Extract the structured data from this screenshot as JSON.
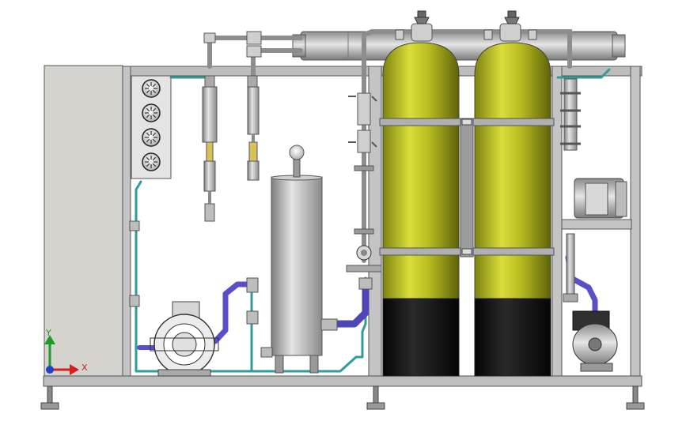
{
  "view": {
    "background": "#ffffff",
    "triad": {
      "x_label": "X",
      "y_label": "Y",
      "x_color": "#d42020",
      "y_color": "#1f9a2a",
      "z_color": "#2340c8"
    }
  },
  "colors": {
    "frame": "#b9b9b9",
    "frame_edge": "#555555",
    "cabinet": "#d4d2cc",
    "tank_yellow": "#b5ba1e",
    "tank_dark": "#121212",
    "steel": "#c2c2c2",
    "pipe_teal": "#2fa3a0",
    "pipe_blue": "#5a4ec9",
    "gauge": "#e9e9e9"
  },
  "gauges": {
    "count": 4
  }
}
